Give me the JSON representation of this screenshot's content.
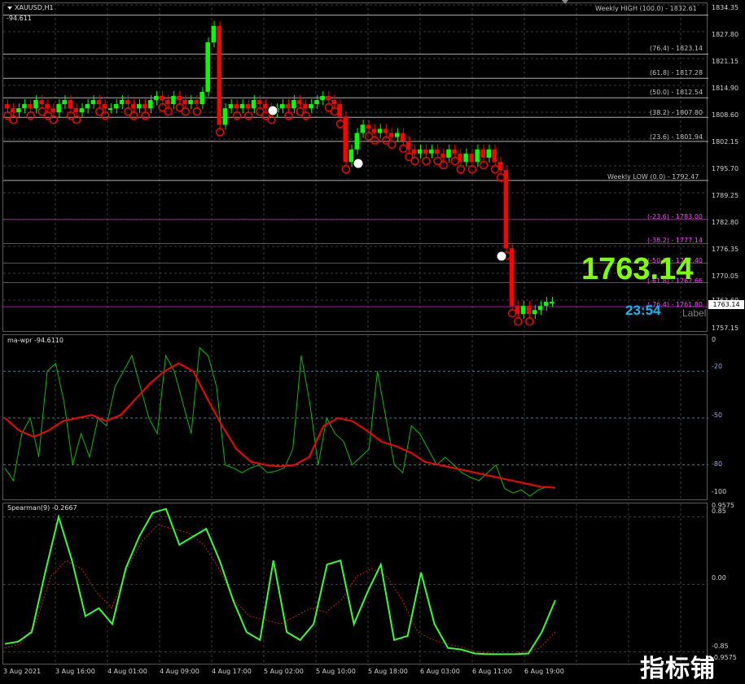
{
  "symbol": "XAUUSD,H1",
  "wpr_reading": "-94.611",
  "big_price": "1763.14",
  "countdown": "23:54",
  "label_text": "Label",
  "price_tag": "1763.14",
  "watermark": "指标铺",
  "colors": {
    "bull": "#00ff00",
    "bear": "#ff0000",
    "ma": "#ff0000",
    "wpr": "#00c000",
    "spearman": "#33ff33",
    "fib_upper": "#c0c0c0",
    "fib_lower": "#ff00ff"
  },
  "price_axis": [
    "1834.35",
    "1827.80",
    "1821.15",
    "1814.90",
    "1808.60",
    "1802.15",
    "1795.70",
    "1789.25",
    "1782.80",
    "1776.35",
    "1770.05",
    "1763.60",
    "1757.15"
  ],
  "fib_labels": [
    {
      "text": "Weekly HIGH (100.0) - 1832.61",
      "price": 1832.61
    },
    {
      "text": "(76.4) - 1823.14",
      "price": 1823.14
    },
    {
      "text": "(61.8) - 1817.28",
      "price": 1817.28
    },
    {
      "text": "(50.0) - 1812.54",
      "price": 1812.54
    },
    {
      "text": "(38.2) - 1807.80",
      "price": 1807.8
    },
    {
      "text": "(23.6) - 1801.94",
      "price": 1801.94
    },
    {
      "text": "Weekly LOW (0.0) - 1792.47",
      "price": 1792.47
    },
    {
      "text": "(-23.6) - 1783.00",
      "price": 1783.0
    },
    {
      "text": "(-38.2) - 1777.14",
      "price": 1777.14
    },
    {
      "text": "(-50.0) - 1772.40",
      "price": 1772.4
    },
    {
      "text": "(-61.8) - 1767.66",
      "price": 1767.66
    },
    {
      "text": "(-76.4) - 1761.80",
      "price": 1761.8
    }
  ],
  "wpr": {
    "title": "ma-wpr -94.6110",
    "levels": [
      "0",
      "-20",
      "-50",
      "-80",
      "-100"
    ]
  },
  "spearman": {
    "title": "Spearman(9) -0.2667",
    "levels": [
      "0.9575",
      "0.85",
      "0.00",
      "-0.85",
      "-0.9575"
    ]
  },
  "time_axis": [
    "3 Aug 2021",
    "3 Aug 16:00",
    "4 Aug 01:00",
    "4 Aug 09:00",
    "4 Aug 17:00",
    "5 Aug 02:00",
    "5 Aug 10:00",
    "5 Aug 18:00",
    "6 Aug 03:00",
    "6 Aug 11:00",
    "6 Aug 19:00"
  ],
  "chart_data": [
    {
      "type": "candlestick",
      "title": "XAUUSD,H1",
      "ylim": [
        1755.5,
        1835.5
      ],
      "close_series": [
        1810,
        1809,
        1810,
        1811,
        1810,
        1812,
        1811,
        1810,
        1809,
        1811,
        1812,
        1810,
        1809,
        1810,
        1811,
        1812,
        1811,
        1810,
        1810,
        1811,
        1812,
        1811,
        1810,
        1811,
        1810,
        1812,
        1813,
        1812,
        1811,
        1813,
        1812,
        1811,
        1812,
        1811,
        1814,
        1826,
        1830,
        1806,
        1810,
        1811,
        1810,
        1811,
        1810,
        1812,
        1811,
        1810,
        1809,
        1810,
        1811,
        1810,
        1812,
        1811,
        1810,
        1811,
        1812,
        1813,
        1812,
        1811,
        1808,
        1797,
        1800,
        1804,
        1806,
        1805,
        1804,
        1805,
        1804,
        1803,
        1804,
        1802,
        1800,
        1799,
        1800,
        1799,
        1800,
        1799,
        1798,
        1800,
        1799,
        1797,
        1799,
        1797,
        1800,
        1798,
        1800,
        1797,
        1795,
        1776,
        1762,
        1760,
        1762,
        1760,
        1761,
        1762,
        1763,
        1763
      ]
    },
    {
      "type": "line",
      "title": "ma-wpr -94.6110",
      "ylim": [
        -100,
        0
      ],
      "series": [
        {
          "name": "wpr",
          "values": [
            -82,
            -90,
            -60,
            -50,
            -75,
            -20,
            -15,
            -40,
            -80,
            -60,
            -75,
            -50,
            -55,
            -30,
            -20,
            -10,
            -30,
            -50,
            -60,
            -10,
            -20,
            -40,
            -60,
            -5,
            -10,
            -30,
            -80,
            -82,
            -85,
            -82,
            -80,
            -85,
            -84,
            -82,
            -70,
            -10,
            -40,
            -80,
            -50,
            -60,
            -65,
            -80,
            -75,
            -70,
            -20,
            -50,
            -80,
            -85,
            -55,
            -60,
            -70,
            -80,
            -75,
            -80,
            -85,
            -88,
            -90,
            -85,
            -80,
            -95,
            -98,
            -96,
            -100,
            -96,
            -94,
            -95
          ]
        },
        {
          "name": "ma",
          "values": [
            -50,
            -58,
            -62,
            -58,
            -52,
            -50,
            -48,
            -52,
            -48,
            -38,
            -28,
            -20,
            -15,
            -20,
            -38,
            -55,
            -70,
            -78,
            -80,
            -81,
            -80,
            -75,
            -55,
            -50,
            -52,
            -58,
            -65,
            -68,
            -72,
            -78,
            -80,
            -82,
            -84,
            -86,
            -88,
            -90,
            -92,
            -94,
            -94.6
          ]
        }
      ]
    },
    {
      "type": "line",
      "title": "Spearman(9) -0.2667",
      "ylim": [
        -0.9575,
        0.9575
      ],
      "series": [
        {
          "name": "spearman",
          "values": [
            -0.75,
            -0.72,
            -0.6,
            0.15,
            0.85,
            0.3,
            -0.4,
            -0.3,
            -0.5,
            0.2,
            0.6,
            0.9,
            0.95,
            0.5,
            0.6,
            0.7,
            0.3,
            -0.2,
            -0.6,
            -0.7,
            0.3,
            -0.6,
            -0.7,
            -0.5,
            0.25,
            0.3,
            -0.5,
            -0.1,
            0.25,
            -0.7,
            -0.65,
            0.15,
            -0.5,
            -0.8,
            -0.82,
            -0.87,
            -0.88,
            -0.88,
            -0.88,
            -0.87,
            -0.6,
            -0.2
          ]
        },
        {
          "name": "signal",
          "values": [
            -0.8,
            -0.75,
            -0.5,
            0.1,
            0.3,
            0.2,
            -0.1,
            -0.3,
            0.2,
            0.55,
            0.75,
            0.7,
            0.65,
            0.5,
            0.2,
            -0.2,
            -0.4,
            -0.45,
            -0.5,
            -0.4,
            -0.3,
            -0.35,
            -0.2,
            0.1,
            0.2,
            0.1,
            -0.2,
            -0.6,
            -0.7,
            -0.75,
            -0.8,
            -0.85,
            -0.87,
            -0.88,
            -0.85,
            -0.8,
            -0.6
          ]
        }
      ]
    }
  ]
}
